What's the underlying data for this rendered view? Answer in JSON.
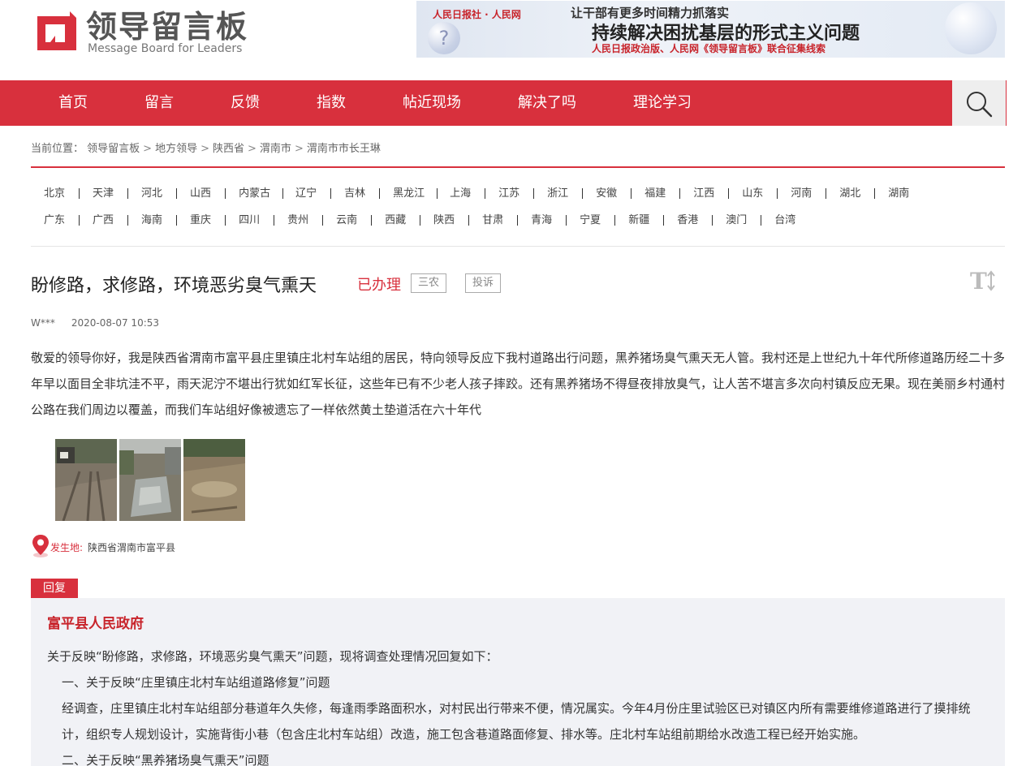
{
  "header": {
    "logo_cn": "领导留言板",
    "logo_en": "Message Board for Leaders",
    "banner": {
      "logos": "人民日报社 · 人民网",
      "line1": "让干部有更多时间精力抓落实",
      "line2": "持续解决困扰基层的形式主义问题",
      "line3": "人民日报政治版、人民网《领导留言板》联合征集线索"
    }
  },
  "nav": {
    "items": [
      "首页",
      "留言",
      "反馈",
      "指数",
      "帖近现场",
      "解决了吗",
      "理论学习"
    ],
    "search_icon": "search-icon"
  },
  "breadcrumb": {
    "prefix": "当前位置：",
    "items": [
      "领导留言板",
      "地方领导",
      "陕西省",
      "渭南市",
      "渭南市市长王琳"
    ]
  },
  "provinces": {
    "row1": [
      "北京",
      "天津",
      "河北",
      "山西",
      "内蒙古",
      "辽宁",
      "吉林",
      "黑龙江",
      "上海",
      "江苏",
      "浙江",
      "安徽",
      "福建",
      "江西",
      "山东",
      "河南",
      "湖北",
      "湖南"
    ],
    "row2": [
      "广东",
      "广西",
      "海南",
      "重庆",
      "四川",
      "贵州",
      "云南",
      "西藏",
      "陕西",
      "甘肃",
      "青海",
      "宁夏",
      "新疆",
      "香港",
      "澳门",
      "台湾"
    ]
  },
  "message": {
    "title": "盼修路，求修路，环境恶劣臭气熏天",
    "status": "已办理",
    "tags": [
      "三农",
      "投诉"
    ],
    "author": "W***",
    "date": "2020-08-07 10:53",
    "body": "敬爱的领导你好，我是陕西省渭南市富平县庄里镇庄北村车站组的居民，特向领导反应下我村道路出行问题，黑养猪场臭气熏天无人管。我村还是上世纪九十年代所修道路历经二十多年早以面目全非坑洼不平，雨天泥泞不堪出行犹如红军长征，这些年已有不少老人孩子摔跤。还有黑养猪场不得昼夜排放臭气，让人苦不堪言多次向村镇反应无果。现在美丽乡村通村公路在我们周边以覆盖，而我们车站组好像被遗忘了一样依然黄土垫道活在六十年代",
    "location_label": "发生地:",
    "location": "陕西省渭南市富平县"
  },
  "reply": {
    "tab": "回复",
    "org": "富平县人民政府",
    "paragraphs": [
      "关于反映“盼修路，求修路，环境恶劣臭气熏天”问题，现将调查处理情况回复如下：",
      "一、关于反映“庄里镇庄北村车站组道路修复”问题",
      "经调查，庄里镇庄北村车站组部分巷道年久失修，每逢雨季路面积水，对村民出行带来不便，情况属实。今年4月份庄里试验区已对镇区内所有需要维修道路进行了摸排统计，组织专人规划设计，实施背街小巷（包含庄北村车站组）改造，施工包含巷道路面修复、排水等。庄北村车站组前期给水改造工程已经开始实施。",
      "二、关于反映“黑养猪场臭气熏天”问题"
    ]
  }
}
